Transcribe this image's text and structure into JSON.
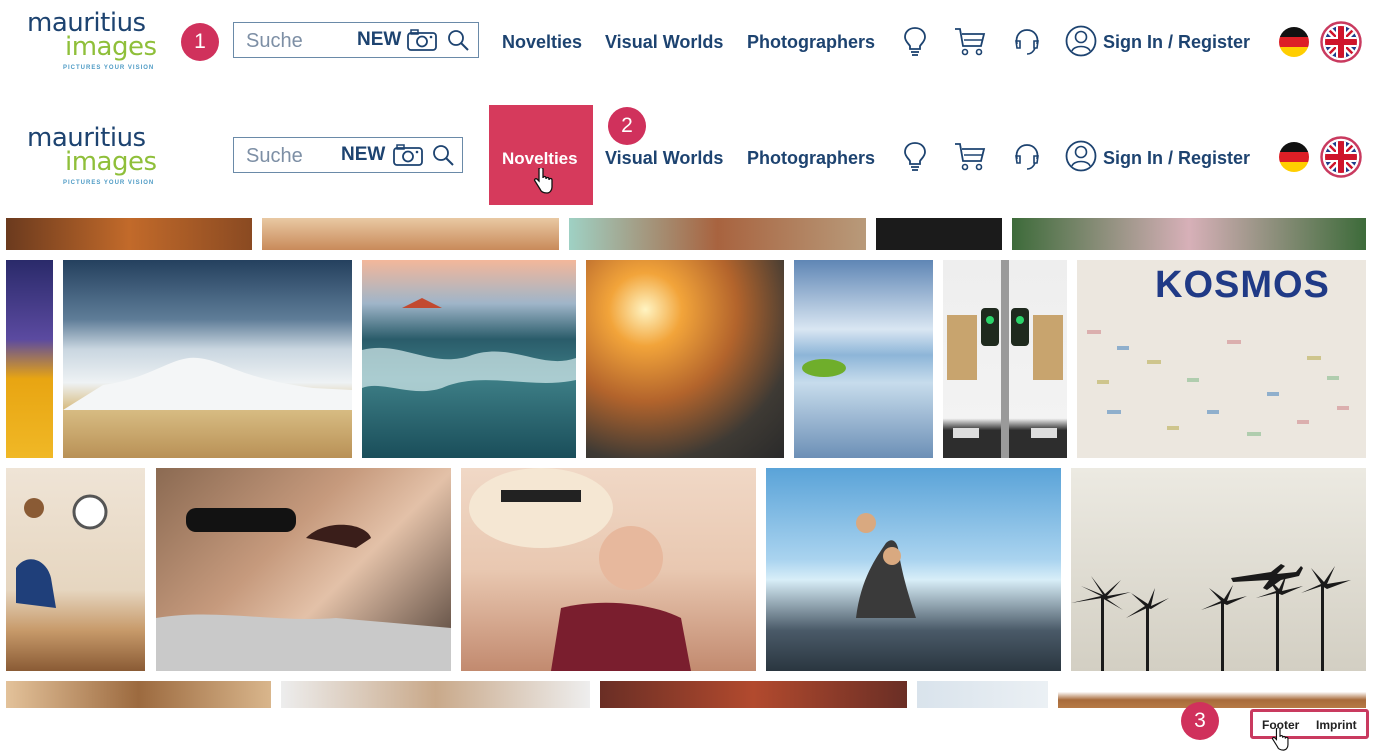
{
  "logo": {
    "line1": "mauritius",
    "line2": "images",
    "tagline": "PICTURES YOUR VISION"
  },
  "search": {
    "placeholder": "Suche",
    "new_label": "NEW"
  },
  "nav": {
    "novelties": "Novelties",
    "visual_worlds": "Visual Worlds",
    "photographers": "Photographers",
    "sign_in": "Sign In / Register"
  },
  "steps": {
    "one": "1",
    "two": "2",
    "three": "3"
  },
  "footer": {
    "footer_link": "Footer",
    "imprint_link": "Imprint"
  },
  "colors": {
    "brand_navy": "#1d4370",
    "brand_green": "#8fbf3a",
    "accent_pink": "#d63a5c"
  },
  "icons": [
    "camera-icon",
    "search-icon",
    "lightbulb-icon",
    "cart-icon",
    "headset-icon",
    "user-icon",
    "flag-de-icon",
    "flag-uk-icon",
    "hand-cursor-icon"
  ],
  "gallery": {
    "row2": [
      {
        "caption": "KOSMOS"
      }
    ]
  }
}
